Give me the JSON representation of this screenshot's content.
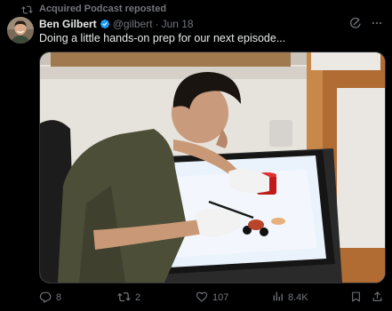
{
  "repost": {
    "label": "Acquired Podcast reposted",
    "icon": "repost-icon"
  },
  "author": {
    "name": "Ben Gilbert",
    "verified": true,
    "handle": "@gilbert",
    "separator": "·",
    "date": "Jun 18"
  },
  "header_icons": [
    "grok-icon",
    "more-icon"
  ],
  "tweet": {
    "text": "Doing a little hands-on prep for our next episode..."
  },
  "media": {
    "alt_icon": "photo",
    "description_visible": false
  },
  "actions": {
    "replies": "8",
    "reposts": "2",
    "likes": "107",
    "views": "8.4K"
  },
  "colors": {
    "background": "#000000",
    "text": "#e7e9ea",
    "muted": "#71767b",
    "verified": "#1d9bf0"
  }
}
